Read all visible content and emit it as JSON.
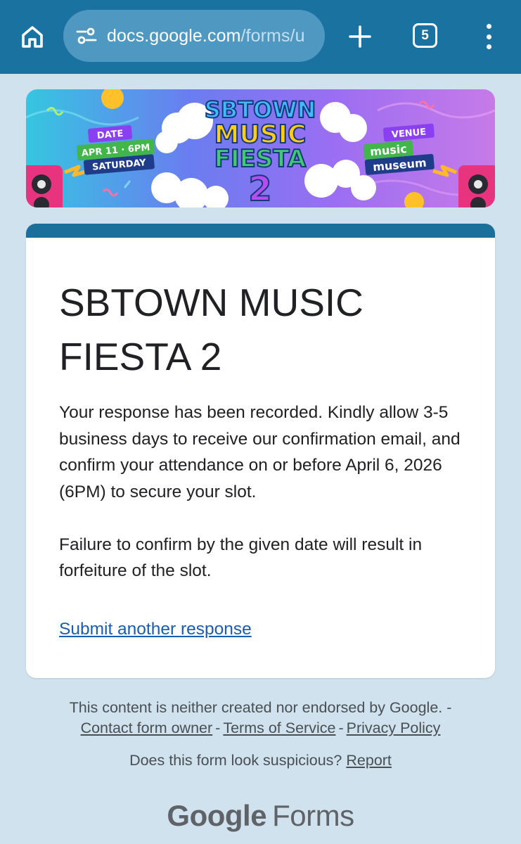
{
  "browser": {
    "url_domain": "docs.google.com",
    "url_path": "/forms/u",
    "tab_count": "5",
    "icons": [
      "home-icon",
      "site-settings-icon",
      "new-tab-icon",
      "tab-switcher-icon",
      "more-options-icon"
    ],
    "bar_color": "#1a72a0"
  },
  "banner": {
    "title_line1": "SBTOWN",
    "title_line2": "MUSIC",
    "title_line3": "FIESTA",
    "title_number": "2",
    "date_label": "DATE",
    "date_line1": "APR 11 · 6PM",
    "date_line2": "SATURDAY",
    "venue_label": "VENUE",
    "venue_line1": "music",
    "venue_line2": "museum"
  },
  "form": {
    "title": "SBTOWN MUSIC FIESTA 2",
    "confirmation_paragraphs": [
      "Your response has been recorded. Kindly allow 3-5 business days to receive our confirmation email, and confirm your attendance on or before April 6, 2026 (6PM) to secure your slot.",
      "Failure to confirm by the given date will result in forfeiture of the slot."
    ],
    "submit_another_label": "Submit another response",
    "accent_color": "#1a6f9b",
    "link_color": "#1a5cb0"
  },
  "footer": {
    "disclaimer": "This content is neither created nor endorsed by Google. -",
    "contact_link": "Contact form owner",
    "terms_link": "Terms of Service",
    "privacy_link": "Privacy Policy",
    "separator": "-",
    "suspicious_text": "Does this form look suspicious?",
    "report_link": "Report",
    "brand_google": "Google",
    "brand_forms": "Forms"
  }
}
